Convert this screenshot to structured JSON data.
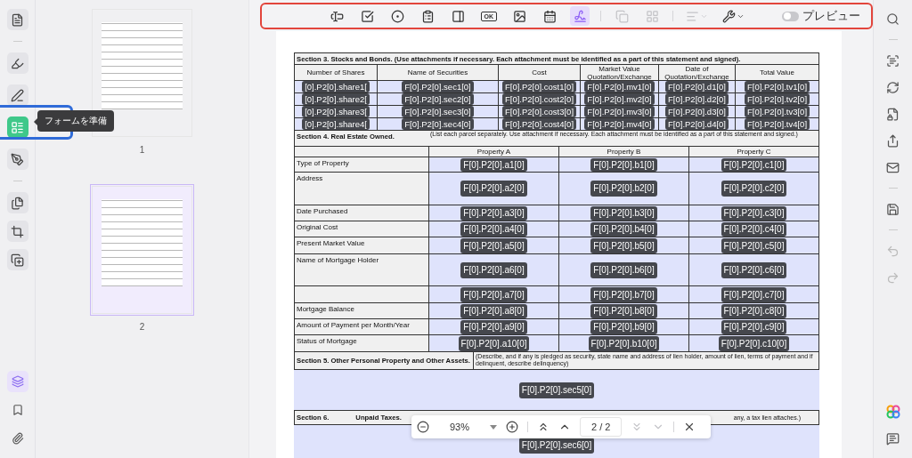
{
  "left_rail": {
    "items": [
      {
        "selected": false
      },
      {
        "selected": false
      },
      {
        "selected": false
      },
      {
        "selected": true
      },
      {
        "selected": false
      },
      {
        "selected": false
      },
      {
        "selected": false
      },
      {
        "selected": false
      }
    ],
    "tooltip": "フォームを準備",
    "bottom_items": [
      {
        "selected": true
      },
      {
        "selected": false
      },
      {
        "selected": false
      }
    ]
  },
  "thumbnails": [
    {
      "label": "1",
      "selected": false
    },
    {
      "label": "2",
      "selected": true
    }
  ],
  "toolbar": {
    "tools": [
      {
        "selected": false,
        "disabled": false,
        "dropdown": false
      },
      {
        "selected": false,
        "disabled": false,
        "dropdown": false
      },
      {
        "selected": false,
        "disabled": false,
        "dropdown": false
      },
      {
        "selected": false,
        "disabled": false,
        "dropdown": false
      },
      {
        "selected": false,
        "disabled": false,
        "dropdown": false
      },
      {
        "selected": false,
        "disabled": false,
        "dropdown": false,
        "text": "OK"
      },
      {
        "selected": false,
        "disabled": false,
        "dropdown": false
      },
      {
        "selected": false,
        "disabled": false,
        "dropdown": false
      },
      {
        "selected": true,
        "disabled": false,
        "dropdown": false
      },
      {
        "selected": false,
        "disabled": true,
        "dropdown": false
      },
      {
        "selected": false,
        "disabled": true,
        "dropdown": false
      },
      {
        "selected": false,
        "disabled": true,
        "dropdown": true
      },
      {
        "selected": false,
        "disabled": false,
        "dropdown": true
      }
    ],
    "preview": {
      "label": "プレビュー",
      "on": false
    }
  },
  "document": {
    "section3": {
      "title": "Section 3.  Stocks and Bonds. (Use attachments if necessary.  Each attachment must be identified as a part of this statement and signed).",
      "columns": [
        "Number of Shares",
        "Name of Securities",
        "Cost",
        "Market Value Quotation/Exchange",
        "Date of Quotation/Exchange",
        "Total Value"
      ],
      "rows": [
        [
          "[0].P2[0].share1[",
          "F[0].P2[0].sec1[0]",
          "F[0].P2[0].cost1[0]",
          "F[0].P2[0].mv1[0]",
          "F[0].P2[0].d1[0]",
          "F[0].P2[0].tv1[0]"
        ],
        [
          "[0].P2[0].share2[",
          "F[0].P2[0].sec2[0]",
          "F[0].P2[0].cost2[0]",
          "F[0].P2[0].mv2[0]",
          "F[0].P2[0].d2[0]",
          "F[0].P2[0].tv2[0]"
        ],
        [
          "[0].P2[0].share3[",
          "F[0].P2[0].sec3[0]",
          "F[0].P2[0].cost3[0]",
          "F[0].P2[0].mv3[0]",
          "F[0].P2[0].d3[0]",
          "F[0].P2[0].tv3[0]"
        ],
        [
          "[0].P2[0].share4[",
          "F[0].P2[0].sec4[0]",
          "F[0].P2[0].cost4[0]",
          "F[0].P2[0].mv4[0]",
          "F[0].P2[0].d4[0]",
          "F[0].P2[0].tv4[0]"
        ]
      ]
    },
    "section4": {
      "title": "Section 4. Real Estate Owned.",
      "note": "(List each parcel separately.  Use attachment if necessary.  Each attachment must be identified as a part of this statement and signed.)",
      "columns": [
        "Property A",
        "Property B",
        "Property C"
      ],
      "rows": [
        {
          "label": "Type of Property",
          "fields": [
            "F[0].P2[0].a1[0]",
            "F[0].P2[0].b1[0]",
            "F[0].P2[0].c1[0]"
          ]
        },
        {
          "label": "Address",
          "fields": [
            "F[0].P2[0].a2[0]",
            "F[0].P2[0].b2[0]",
            "F[0].P2[0].c2[0]"
          ]
        },
        {
          "label": "Date Purchased",
          "fields": [
            "F[0].P2[0].a3[0]",
            "F[0].P2[0].b3[0]",
            "F[0].P2[0].c3[0]"
          ]
        },
        {
          "label": "Original Cost",
          "fields": [
            "F[0].P2[0].a4[0]",
            "F[0].P2[0].b4[0]",
            "F[0].P2[0].c4[0]"
          ]
        },
        {
          "label": "Present Market Value",
          "fields": [
            "F[0].P2[0].a5[0]",
            "F[0].P2[0].b5[0]",
            "F[0].P2[0].c5[0]"
          ]
        },
        {
          "label": "Name of Mortgage Holder",
          "fields": [
            "F[0].P2[0].a6[0]",
            "F[0].P2[0].b6[0]",
            "F[0].P2[0].c6[0]"
          ]
        },
        {
          "fields": [
            "F[0].P2[0].a7[0]",
            "F[0].P2[0].b7[0]",
            "F[0].P2[0].c7[0]"
          ]
        },
        {
          "label": "Mortgage Balance",
          "fields": [
            "F[0].P2[0].a8[0]",
            "F[0].P2[0].b8[0]",
            "F[0].P2[0].c8[0]"
          ]
        },
        {
          "label": "Amount of Payment per Month/Year",
          "fields": [
            "F[0].P2[0].a9[0]",
            "F[0].P2[0].b9[0]",
            "F[0].P2[0].c9[0]"
          ]
        },
        {
          "label": "Status of Mortgage",
          "fields": [
            "F[0].P2[0].a10[0]",
            "F[0].P2[0].b10[0]",
            "F[0].P2[0].c10[0]"
          ]
        }
      ]
    },
    "section5": {
      "title": "Section 5. Other Personal Property and Other Assets.",
      "note": "(Describe, and if any is pledged as security, state name and address of lien holder, amount of lien, terms of payment and if delinquent, describe delinquency)",
      "field": "F[0].P2[0].sec5[0]"
    },
    "section6": {
      "title": "Section 6.",
      "subtitle": "Unpaid Taxes.",
      "note": "any, a tax lien attaches.)",
      "field": "F[0].P2[0].sec6[0]"
    }
  },
  "zoom_bar": {
    "zoom": "93%",
    "page": "2 / 2"
  }
}
